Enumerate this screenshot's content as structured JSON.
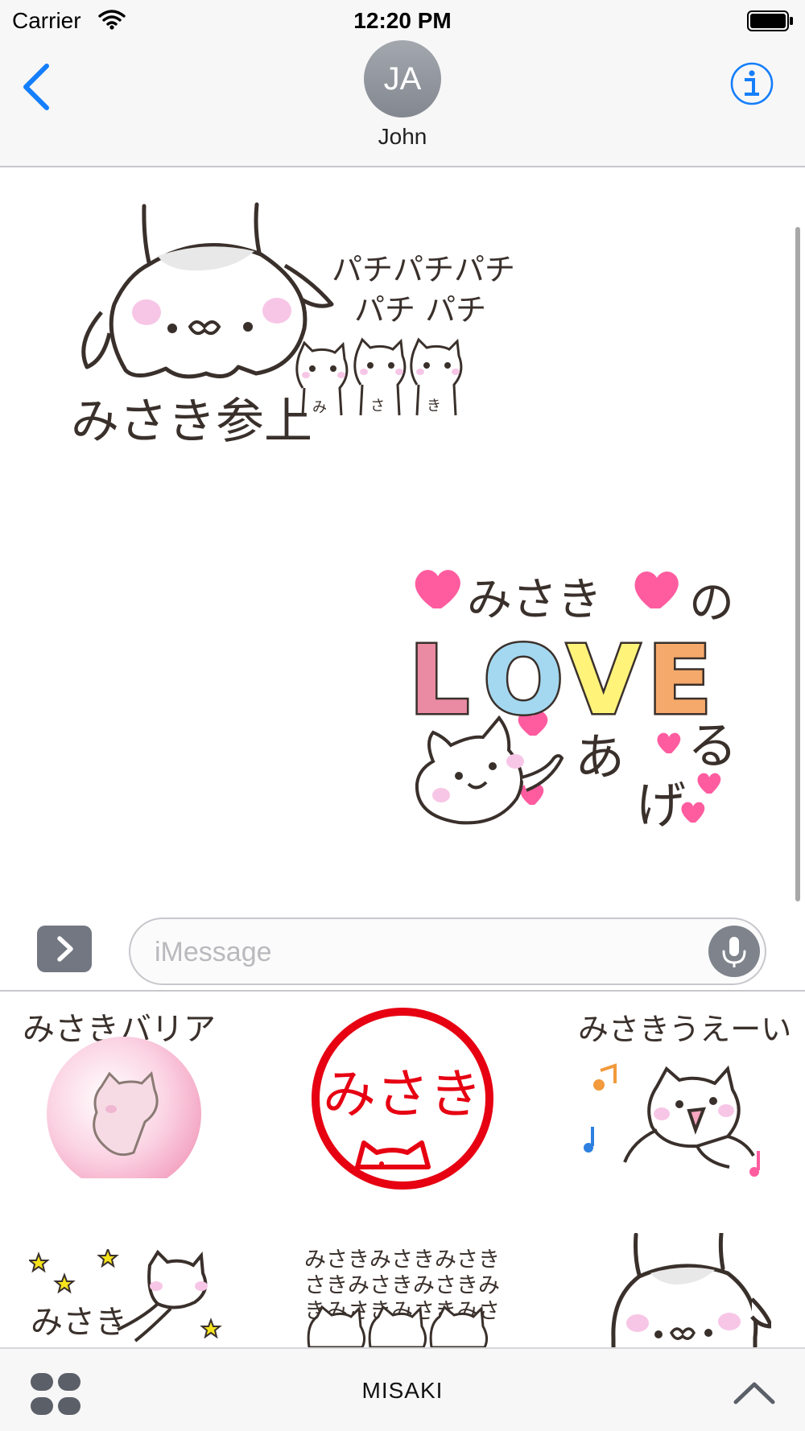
{
  "status_bar": {
    "carrier": "Carrier",
    "time": "12:20 PM"
  },
  "header": {
    "contact_initials": "JA",
    "contact_name": "John"
  },
  "messages": [
    {
      "kind": "sticker",
      "caption_top": "パチパチパチ",
      "caption_mid": "パチ パチ",
      "caption_main": "みさき参上",
      "mini_labels": [
        "み",
        "さ",
        "き"
      ]
    },
    {
      "kind": "sticker",
      "name": "みさき",
      "particle": "の",
      "word": "LOVE",
      "word_letters": [
        "L",
        "O",
        "V",
        "E"
      ],
      "verb_1": "あ",
      "verb_2": "げ",
      "verb_3": "る"
    }
  ],
  "compose": {
    "placeholder": "iMessage",
    "value": ""
  },
  "drawer": {
    "stickers": [
      {
        "caption": "みさきバリア"
      },
      {
        "caption": "みさき"
      },
      {
        "caption": "みさきうえーい"
      },
      {
        "caption": "みさき"
      },
      {
        "lines": [
          "みさきみさきみさき",
          "さきみさきみさきみ",
          "きみさきみさきみさ"
        ]
      },
      {
        "caption": ""
      }
    ]
  },
  "bottom_bar": {
    "pack_name": "MISAKI"
  },
  "colors": {
    "ios_blue": "#147efb",
    "avatar_gray": "#8e9299",
    "blush_pink": "#f7c6e6",
    "heart_pink": "#ff5ca0",
    "stamp_red": "#e60012",
    "love_L": "#ea8aa3",
    "love_O": "#a3d8f0",
    "love_V": "#fff37a",
    "love_E": "#f5a96a"
  },
  "icons": {
    "signal": "wifi-icon",
    "battery": "battery-icon",
    "back": "chevron-left-icon",
    "info": "info-icon",
    "apps": "chevron-right-icon",
    "mic": "microphone-icon",
    "drawer": "app-grid-icon",
    "expand": "chevron-up-icon"
  }
}
